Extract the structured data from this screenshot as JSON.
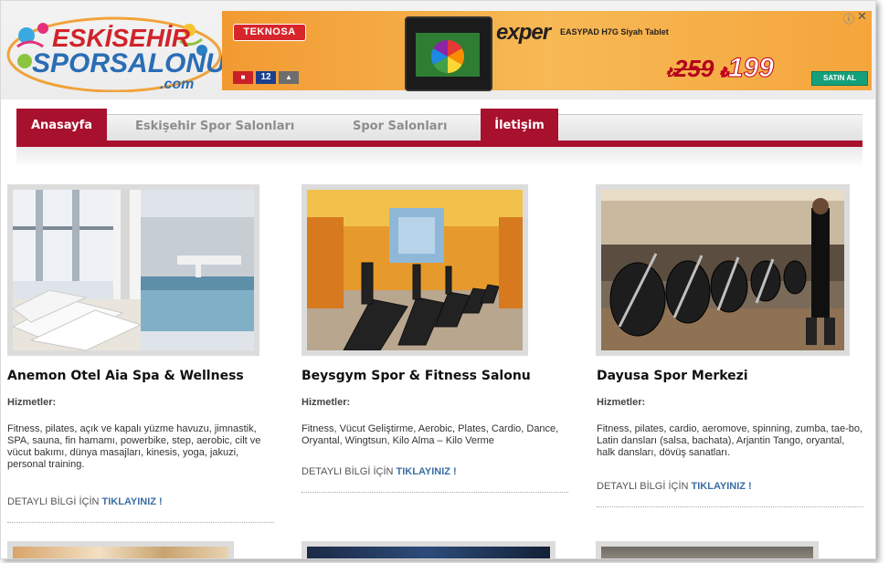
{
  "site": {
    "logo_line1": "ESKİSEHİR",
    "logo_line2": "SPORSALONU",
    "logo_line3": ".com"
  },
  "ad": {
    "store": "TEKNOSA",
    "installments": "12",
    "brand": "exper",
    "model": "EASYPAD H7G Siyah Tablet",
    "old_price": "259",
    "new_price": "199",
    "currency": "₺",
    "buy_label": "SATIN AL",
    "choices_icon": "ⓘ",
    "close_icon": "✕"
  },
  "nav": {
    "items": [
      {
        "label": "Anasayfa",
        "active": true
      },
      {
        "label": "Eskişehir Spor Salonları",
        "active": false
      },
      {
        "label": "Spor Salonları",
        "active": false
      },
      {
        "label": "İletişim",
        "active": true
      }
    ]
  },
  "cards": [
    {
      "title": "Anemon Otel Aia Spa & Wellness",
      "services_label": "Hizmetler:",
      "description": "Fitness, pilates, açık ve kapalı yüzme havuzu, jimnastik, SPA, sauna, fin hamamı, powerbike, step, aerobic, cilt ve vücut bakımı, dünya masajları, kinesis, yoga, jakuzi, personal training.",
      "detail_prefix": "DETAYLI BİLGİ İÇİN",
      "detail_link": "TIKLAYINIZ !"
    },
    {
      "title": "Beysgym Spor & Fitness Salonu",
      "services_label": "Hizmetler:",
      "description": "Fitness, Vücut Geliştirme, Aerobic, Plates, Cardio, Dance, Oryantal, Wingtsun, Kilo Alma – Kilo Verme",
      "detail_prefix": "DETAYLI BİLGİ İÇİN",
      "detail_link": "TIKLAYINIZ !"
    },
    {
      "title": "Dayusa Spor Merkezi",
      "services_label": "Hizmetler:",
      "description": "Fitness, pilates, cardio, aeromove, spinning, zumba, tae-bo, Latin dansları (salsa, bachata), Arjantin Tango, oryantal, halk dansları, dövüş sanatları.",
      "detail_prefix": "DETAYLI BİLGİ İÇİN",
      "detail_link": "TIKLAYINIZ !"
    }
  ],
  "colors": {
    "accent": "#a8112e",
    "link": "#3a6ea5"
  }
}
